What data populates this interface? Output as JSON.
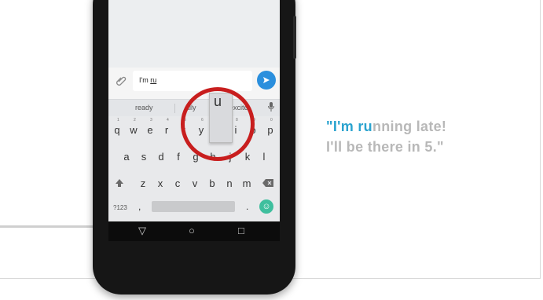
{
  "message": {
    "typed_prefix": "I'm ",
    "typed_underlined": "ru",
    "send_icon": "arrow-icon"
  },
  "suggestions": {
    "left": "ready",
    "middle": "ally",
    "right": "excite"
  },
  "keyboard": {
    "row1": [
      "q",
      "w",
      "e",
      "r",
      "t",
      "y",
      "u",
      "i",
      "o",
      "p"
    ],
    "row1_nums": [
      "1",
      "2",
      "3",
      "4",
      "5",
      "6",
      "7",
      "8",
      "9",
      "0"
    ],
    "row2": [
      "a",
      "s",
      "d",
      "f",
      "g",
      "h",
      "j",
      "k",
      "l"
    ],
    "row3": [
      "z",
      "x",
      "c",
      "v",
      "b",
      "n",
      "m"
    ],
    "mode_key": "?123",
    "comma": ",",
    "period": ".",
    "popup_key": "u"
  },
  "nav": {
    "back": "▽",
    "home": "○",
    "recent": "□"
  },
  "caption": {
    "open_quote": "\"I'm ",
    "highlight": "ru",
    "rest_line1": "nning late!",
    "line2": "I'll be there in 5.\""
  },
  "colors": {
    "accent_blue": "#2aa3cf",
    "highlight_ring": "#c81e1e",
    "send_button": "#2b8fdd",
    "emoji_button": "#3fbf9e"
  }
}
